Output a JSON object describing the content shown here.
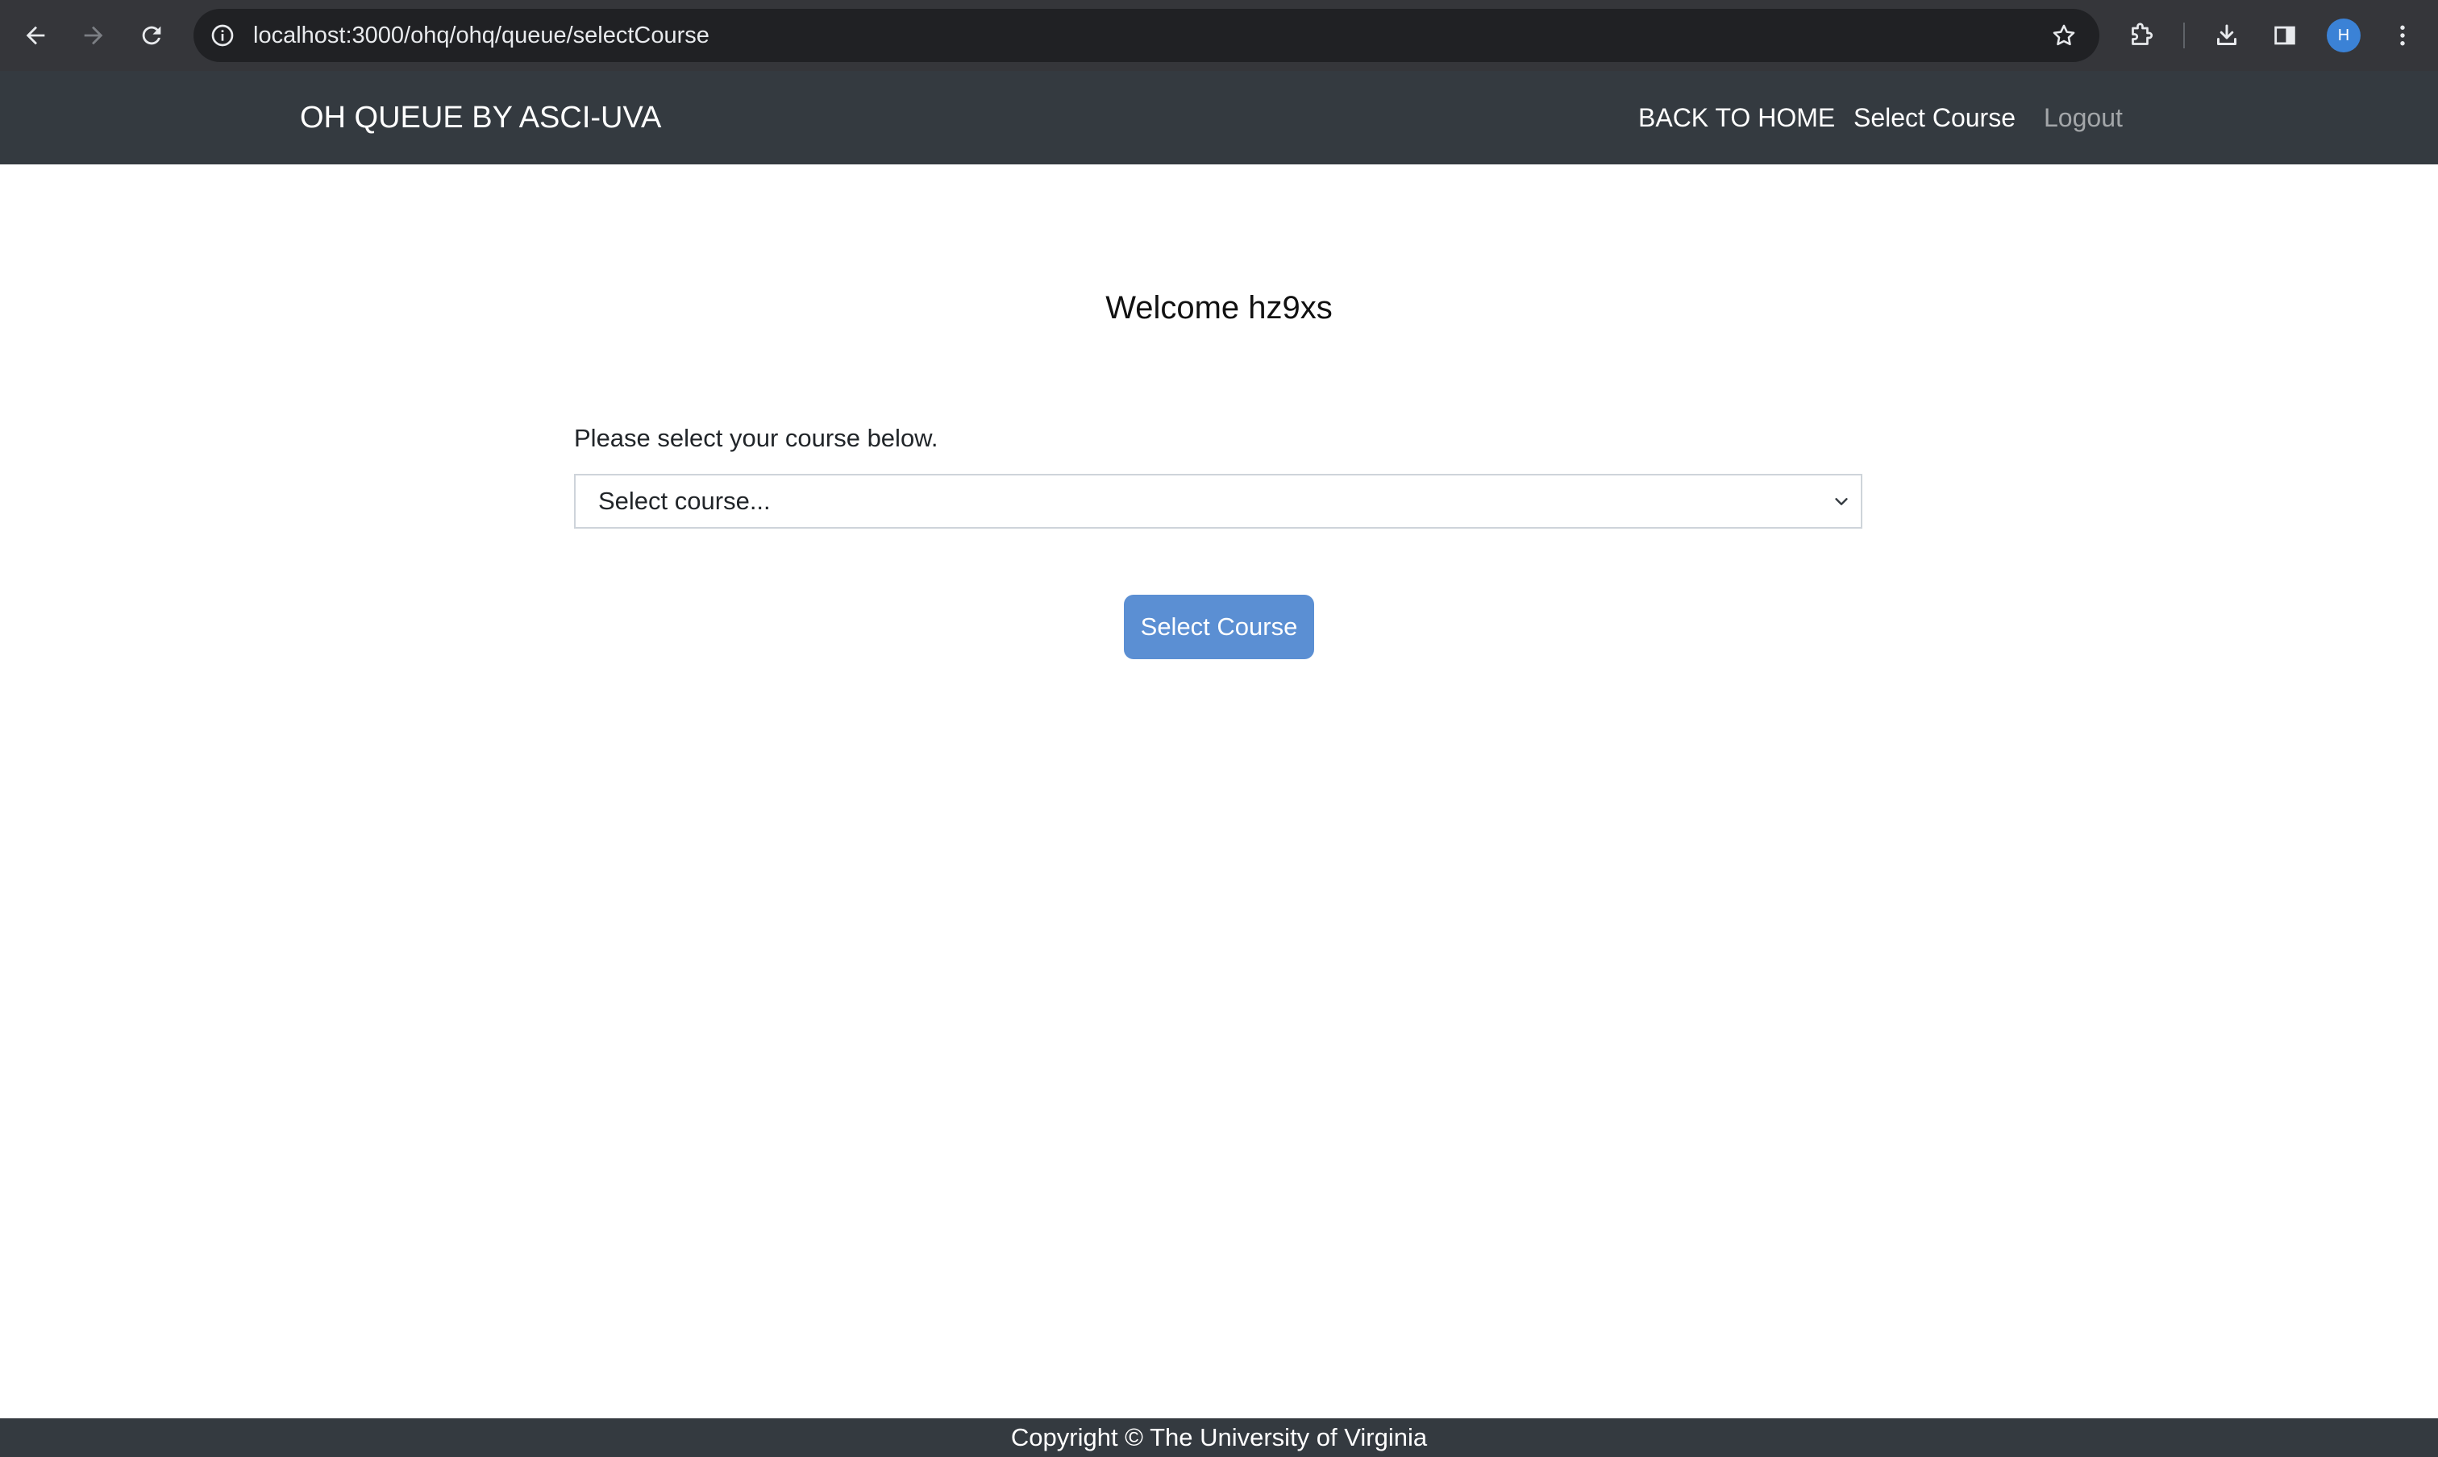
{
  "browser": {
    "url": "localhost:3000/ohq/ohq/queue/selectCourse",
    "profile_initial": "H",
    "icons": [
      "back-icon",
      "forward-icon",
      "reload-icon",
      "info-icon",
      "star-icon",
      "extensions-icon",
      "download-icon",
      "side-panel-icon",
      "profile-avatar",
      "more-vert-icon"
    ]
  },
  "navbar": {
    "brand": "OH QUEUE BY ASCI-UVA",
    "links": [
      {
        "label": "BACK TO HOME"
      },
      {
        "label": "Select Course"
      },
      {
        "label": "Logout"
      }
    ]
  },
  "main": {
    "welcome": "Welcome hz9xs",
    "prompt": "Please select your course below.",
    "select": {
      "selected": "Select course..."
    },
    "submit_label": "Select Course"
  },
  "footer": {
    "text": "Copyright © The University of Virginia"
  },
  "colors": {
    "chrome_bg": "#35363a",
    "omnibox_bg": "#202124",
    "navbar_bg": "#343a40",
    "button_bg": "#5b8fd3",
    "avatar_bg": "#3b82d6"
  }
}
